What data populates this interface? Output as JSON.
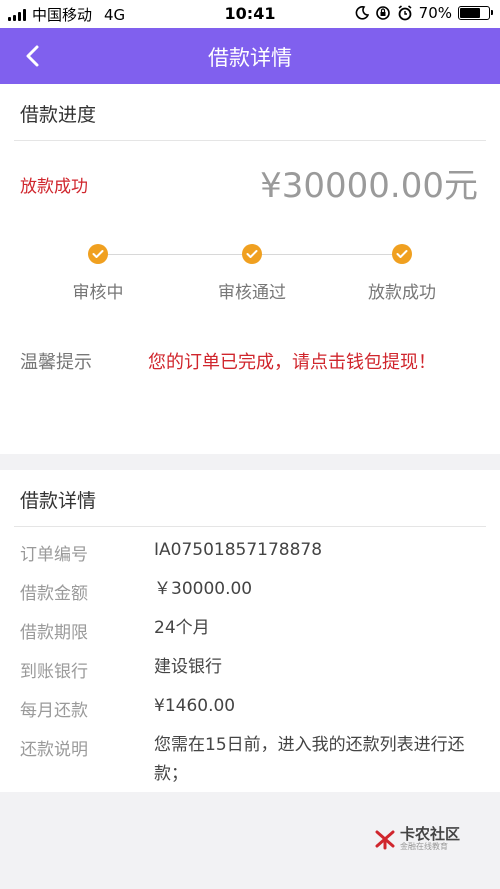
{
  "status_bar": {
    "carrier": "中国移动",
    "network": "4G",
    "time": "10:41",
    "battery_percent": "70%",
    "battery_level": 0.7
  },
  "nav": {
    "title": "借款详情",
    "back_icon": "chevron-left-icon"
  },
  "progress_section": {
    "title": "借款进度",
    "status": "放款成功",
    "amount": "¥30000.00元",
    "steps": [
      {
        "label": "审核中",
        "done": true
      },
      {
        "label": "审核通过",
        "done": true
      },
      {
        "label": "放款成功",
        "done": true
      }
    ],
    "tip_label": "温馨提示",
    "tip_message": "您的订单已完成，请点击钱包提现！"
  },
  "details_section": {
    "title": "借款详情",
    "rows": [
      {
        "key": "订单编号",
        "value": "IA07501857178878"
      },
      {
        "key": "借款金额",
        "value": "￥30000.00"
      },
      {
        "key": "借款期限",
        "value": "24个月"
      },
      {
        "key": "到账银行",
        "value": "建设银行"
      },
      {
        "key": "每月还款",
        "value": "¥1460.00"
      },
      {
        "key": "还款说明",
        "value": "您需在15日前，进入我的还款列表进行还款；"
      }
    ]
  },
  "watermark": {
    "name": "卡农社区",
    "sub": "金融在线教育"
  },
  "colors": {
    "nav_bg": "#8060ee",
    "accent_red": "#d0262d",
    "step_orange": "#f0a020"
  }
}
